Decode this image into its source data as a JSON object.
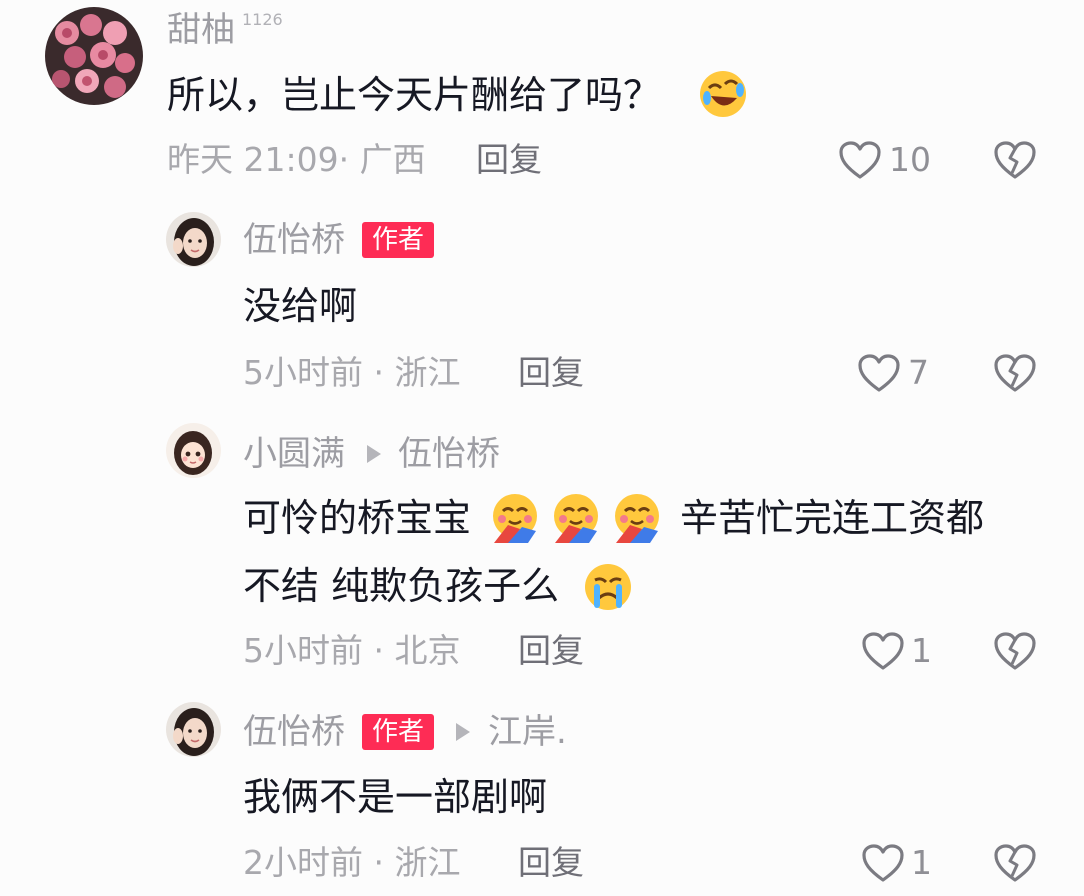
{
  "comments": [
    {
      "user": "甜柚",
      "badge_number": "1126",
      "text": "所以，岂止今天片酬给了吗？",
      "time_location": "昨天 21:09· 广西",
      "reply_label": "回复",
      "likes": "10",
      "avatar_icon": "rose-flowers-avatar",
      "emoji_icon": "rolling-laughing-emoji"
    },
    {
      "user": "伍怡桥",
      "author_label": "作者",
      "text": "没给啊",
      "time_location": "5小时前 · 浙江",
      "reply_label": "回复",
      "likes": "7",
      "avatar_icon": "girl-photo-avatar"
    },
    {
      "user": "小圆满",
      "reply_to": "伍怡桥",
      "text_line1": "可怜的桥宝宝",
      "text_line1_rest": "辛苦忙完连工资都",
      "text_line2": "不结 纯欺负孩子么",
      "time_location": "5小时前 · 北京",
      "reply_label": "回复",
      "likes": "1",
      "avatar_icon": "cartoon-girl-avatar",
      "emoji_icons": [
        "hugging-face-emoji",
        "hugging-face-emoji",
        "hugging-face-emoji",
        "crying-face-emoji"
      ]
    },
    {
      "user": "伍怡桥",
      "author_label": "作者",
      "reply_to": "江岸.",
      "text": "我俩不是一部剧啊",
      "time_location": "2小时前 · 浙江",
      "reply_label": "回复",
      "likes": "1",
      "avatar_icon": "girl-photo-avatar"
    }
  ],
  "colors": {
    "author_badge": "#fe2c55",
    "name": "#9d9da3",
    "text": "#161823",
    "meta": "#a8a8ad"
  }
}
